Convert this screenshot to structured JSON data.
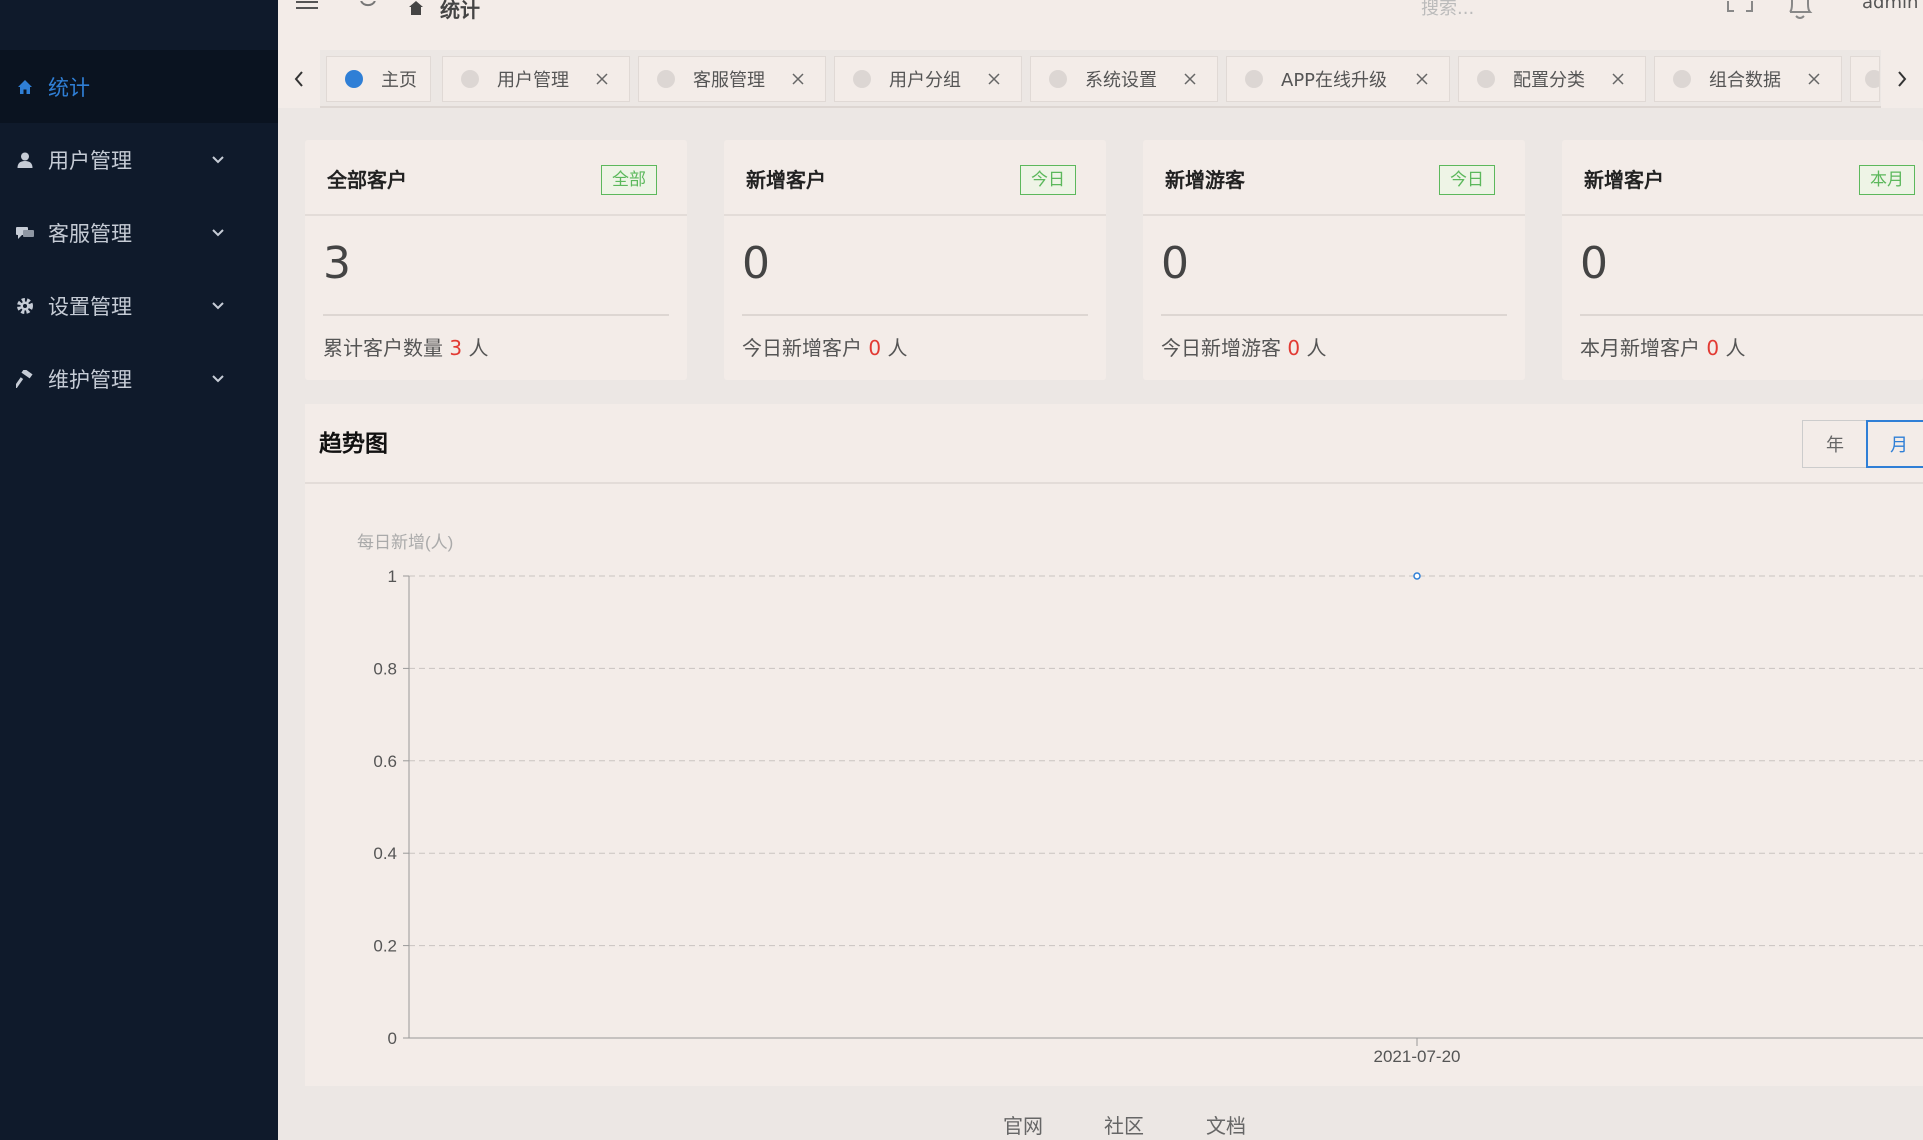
{
  "sidebar": {
    "items": [
      {
        "label": "统计",
        "icon": "home-icon",
        "active": true
      },
      {
        "label": "用户管理",
        "icon": "user-icon"
      },
      {
        "label": "客服管理",
        "icon": "chat-icon"
      },
      {
        "label": "设置管理",
        "icon": "gear-icon"
      },
      {
        "label": "维护管理",
        "icon": "hammer-icon"
      }
    ]
  },
  "topbar": {
    "breadcrumb": "统计",
    "search_placeholder": "搜索...",
    "user": "admin"
  },
  "tabs": [
    {
      "label": "主页",
      "active": true
    },
    {
      "label": "用户管理"
    },
    {
      "label": "客服管理"
    },
    {
      "label": "用户分组"
    },
    {
      "label": "系统设置"
    },
    {
      "label": "APP在线升级"
    },
    {
      "label": "配置分类"
    },
    {
      "label": "组合数据"
    }
  ],
  "cards": [
    {
      "title": "全部客户",
      "badge": "全部",
      "value": "3",
      "foot_prefix": "累计客户数量",
      "foot_num": "3",
      "foot_unit": "人"
    },
    {
      "title": "新增客户",
      "badge": "今日",
      "value": "0",
      "foot_prefix": "今日新增客户",
      "foot_num": "0",
      "foot_unit": "人"
    },
    {
      "title": "新增游客",
      "badge": "今日",
      "value": "0",
      "foot_prefix": "今日新增游客",
      "foot_num": "0",
      "foot_unit": "人"
    },
    {
      "title": "新增客户",
      "badge": "本月",
      "value": "0",
      "foot_prefix": "本月新增客户",
      "foot_num": "0",
      "foot_unit": "人"
    }
  ],
  "trend": {
    "title": "趋势图",
    "toggle_year": "年",
    "toggle_month": "月"
  },
  "chart_data": {
    "type": "line",
    "title": "",
    "ylabel": "每日新增(人)",
    "xlabel": "",
    "x": [
      "2021-07-20"
    ],
    "series": [
      {
        "values": [
          1
        ]
      }
    ],
    "ylim": [
      0,
      1
    ],
    "yticks": [
      0,
      0.2,
      0.4,
      0.6,
      0.8,
      1
    ],
    "ytick_labels": [
      "0",
      "0.2",
      "0.4",
      "0.6",
      "0.8",
      "1"
    ],
    "grid": true,
    "color": "#2f7fd6"
  },
  "footer": {
    "links": [
      "官网",
      "社区",
      "文档"
    ]
  },
  "colors": {
    "accent": "#2f7fd6",
    "badge_green": "#5cb85c",
    "number_red": "#e23a33",
    "sidebar": "#0f1a2b"
  }
}
